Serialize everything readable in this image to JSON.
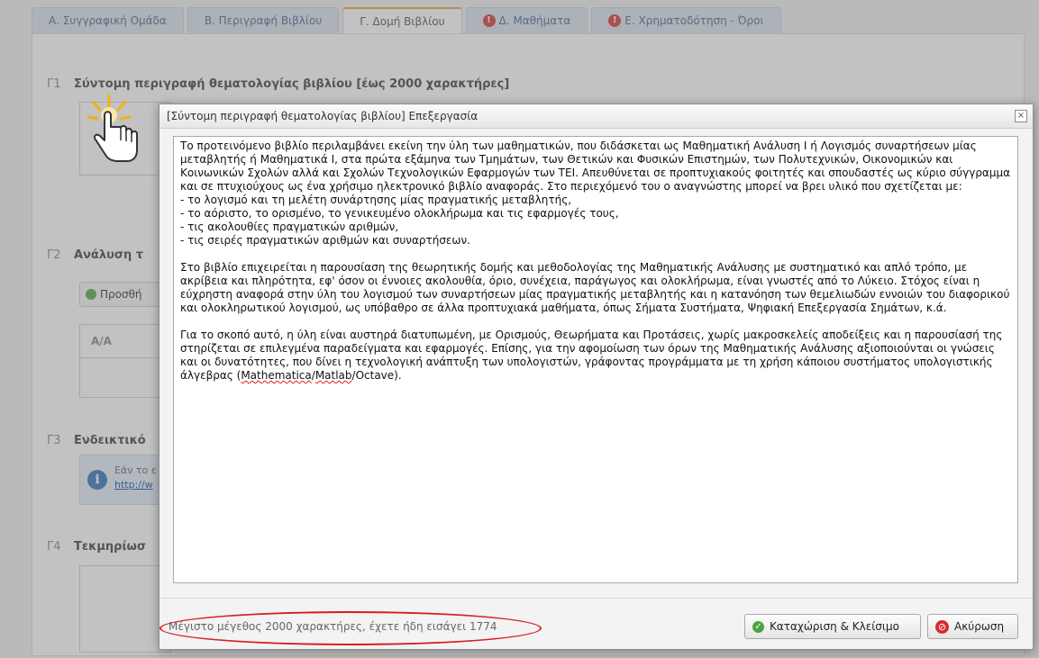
{
  "tabs": [
    {
      "label": "Α. Συγγραφική Ομάδα",
      "warning": false,
      "active": false
    },
    {
      "label": "Β. Περιγραφή Βιβλίου",
      "warning": false,
      "active": false
    },
    {
      "label": "Γ. Δομή Βιβλίου",
      "warning": false,
      "active": true
    },
    {
      "label": "Δ. Μαθήματα",
      "warning": true,
      "active": false
    },
    {
      "label": "Ε. Χρηματοδότηση - Όροι",
      "warning": true,
      "active": false
    }
  ],
  "sections": {
    "g1": {
      "num": "Γ1",
      "title": "Σύντομη περιγραφή θεματολογίας βιβλίου [έως 2000 χαρακτήρες]"
    },
    "g2": {
      "num": "Γ2",
      "title": "Ανάλυση τ"
    },
    "g3": {
      "num": "Γ3",
      "title": "Ενδεικτικό"
    },
    "g4": {
      "num": "Γ4",
      "title": "Τεκμηρίωσ"
    }
  },
  "add_button_label": "Προσθή",
  "table_header": "Α/Α",
  "info_box": {
    "line1": "Εάν το ε",
    "link": "http://w"
  },
  "dialog": {
    "title": "[Σύντομη περιγραφή θεματολογίας βιβλίου] Επεξεργασία",
    "close": "×",
    "body": {
      "p1": "Το προτεινόμενο βιβλίο περιλαμβάνει εκείνη την ύλη των μαθηματικών, που διδάσκεται ως Μαθηματική Ανάλυση Ι ή Λογισμός συναρτήσεων μίας μεταβλητής ή Μαθηματικά Ι, στα πρώτα εξάμηνα των Τμημάτων, των Θετικών και Φυσικών Επιστημών, των Πολυτεχνικών, Οικονομικών και Κοινωνικών Σχολών αλλά και Σχολών Τεχνολογικών Εφαρμογών των ΤΕΙ. Απευθύνεται σε προπτυχιακούς φοιτητές και σπουδαστές ως κύριο σύγγραμμα και σε πτυχιούχους ως ένα χρήσιμο ηλεκτρονικό βιβλίο αναφοράς. Στο περιεχόμενό του ο αναγνώστης μπορεί να βρει υλικό που σχετίζεται με:",
      "bullets": [
        "- το λογισμό και τη μελέτη συνάρτησης μίας πραγματικής μεταβλητής,",
        "- το αόριστο, το ορισμένο, το γενικευμένο ολοκλήρωμα και τις εφαρμογές τους,",
        "- τις ακολουθίες πραγματικών αριθμών,",
        "- τις σειρές πραγματικών αριθμών και συναρτήσεων."
      ],
      "p2": "Στο βιβλίο επιχειρείται η παρουσίαση της θεωρητικής δομής και μεθοδολογίας της Μαθηματικής Ανάλυσης με συστηματικό και απλό τρόπο, με ακρίβεια και πληρότητα, εφ' όσον οι έννοιες ακολουθία, όριο, συνέχεια, παράγωγος και ολοκλήρωμα, είναι γνωστές από το Λύκειο. Στόχος είναι η εύχρηστη αναφορά στην ύλη του λογισμού των συναρτήσεων μίας πραγματικής μεταβλητής και η κατανόηση των θεμελιωδών εννοιών του διαφορικού και ολοκληρωτικού λογισμού, ως υπόβαθρο σε άλλα προπτυχιακά μαθήματα, όπως Σήματα Συστήματα, Ψηφιακή Επεξεργασία Σημάτων, κ.ά.",
      "p3_start": "Για το σκοπό αυτό, η ύλη είναι αυστηρά διατυπωμένη, με Ορισμούς, Θεωρήματα και Προτάσεις, χωρίς μακροσκελείς αποδείξεις και η παρουσίασή της στηρίζεται σε επιλεγμένα παραδείγματα και εφαρμογές. Επίσης, για την αφομοίωση των όρων της Μαθηματικής Ανάλυσης αξιοποιούνται οι γνώσεις και οι δυνατότητες, που δίνει η τεχνολογική ανάπτυξη των υπολογιστών, γράφοντας προγράμματα με τη χρήση κάποιου συστήματος υπολογιστικής άλγεβρας (",
      "p3_sw1": "Mathematica",
      "p3_slash1": "/",
      "p3_sw2": "Matlab",
      "p3_end": "/Octave)."
    },
    "counter": "Μέγιστο μέγεθος 2000 χαρακτήρες, έχετε ήδη εισάγει 1774",
    "save_label": "Καταχώριση & Κλείσιμο",
    "cancel_label": "Ακύρωση"
  },
  "colors": {
    "accent_tab": "#e8a44a",
    "highlight_oval": "#d62020",
    "save_icon": "#4aa443",
    "cancel_icon": "#d62b2b"
  },
  "icons": {
    "warning": "warning-icon",
    "cursor": "hand-pointer-icon",
    "info": "info-icon",
    "close": "close-icon",
    "save": "check-circle-icon",
    "cancel": "cancel-circle-icon"
  }
}
